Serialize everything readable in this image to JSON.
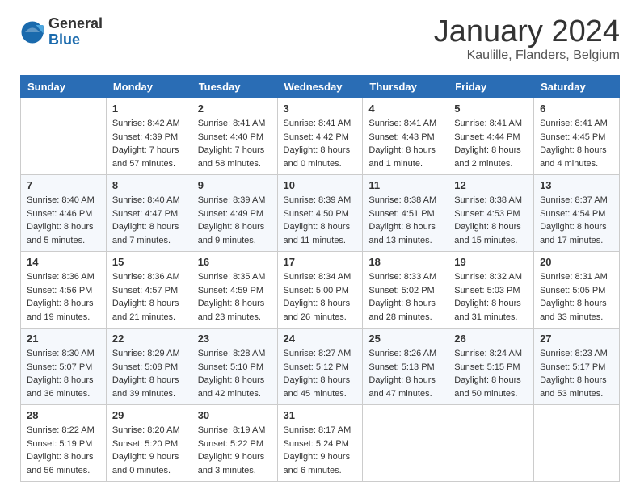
{
  "header": {
    "logo_general": "General",
    "logo_blue": "Blue",
    "month_title": "January 2024",
    "location": "Kaulille, Flanders, Belgium"
  },
  "days_of_week": [
    "Sunday",
    "Monday",
    "Tuesday",
    "Wednesday",
    "Thursday",
    "Friday",
    "Saturday"
  ],
  "weeks": [
    [
      {
        "day": "",
        "info": ""
      },
      {
        "day": "1",
        "info": "Sunrise: 8:42 AM\nSunset: 4:39 PM\nDaylight: 7 hours\nand 57 minutes."
      },
      {
        "day": "2",
        "info": "Sunrise: 8:41 AM\nSunset: 4:40 PM\nDaylight: 7 hours\nand 58 minutes."
      },
      {
        "day": "3",
        "info": "Sunrise: 8:41 AM\nSunset: 4:42 PM\nDaylight: 8 hours\nand 0 minutes."
      },
      {
        "day": "4",
        "info": "Sunrise: 8:41 AM\nSunset: 4:43 PM\nDaylight: 8 hours\nand 1 minute."
      },
      {
        "day": "5",
        "info": "Sunrise: 8:41 AM\nSunset: 4:44 PM\nDaylight: 8 hours\nand 2 minutes."
      },
      {
        "day": "6",
        "info": "Sunrise: 8:41 AM\nSunset: 4:45 PM\nDaylight: 8 hours\nand 4 minutes."
      }
    ],
    [
      {
        "day": "7",
        "info": "Sunrise: 8:40 AM\nSunset: 4:46 PM\nDaylight: 8 hours\nand 5 minutes."
      },
      {
        "day": "8",
        "info": "Sunrise: 8:40 AM\nSunset: 4:47 PM\nDaylight: 8 hours\nand 7 minutes."
      },
      {
        "day": "9",
        "info": "Sunrise: 8:39 AM\nSunset: 4:49 PM\nDaylight: 8 hours\nand 9 minutes."
      },
      {
        "day": "10",
        "info": "Sunrise: 8:39 AM\nSunset: 4:50 PM\nDaylight: 8 hours\nand 11 minutes."
      },
      {
        "day": "11",
        "info": "Sunrise: 8:38 AM\nSunset: 4:51 PM\nDaylight: 8 hours\nand 13 minutes."
      },
      {
        "day": "12",
        "info": "Sunrise: 8:38 AM\nSunset: 4:53 PM\nDaylight: 8 hours\nand 15 minutes."
      },
      {
        "day": "13",
        "info": "Sunrise: 8:37 AM\nSunset: 4:54 PM\nDaylight: 8 hours\nand 17 minutes."
      }
    ],
    [
      {
        "day": "14",
        "info": "Sunrise: 8:36 AM\nSunset: 4:56 PM\nDaylight: 8 hours\nand 19 minutes."
      },
      {
        "day": "15",
        "info": "Sunrise: 8:36 AM\nSunset: 4:57 PM\nDaylight: 8 hours\nand 21 minutes."
      },
      {
        "day": "16",
        "info": "Sunrise: 8:35 AM\nSunset: 4:59 PM\nDaylight: 8 hours\nand 23 minutes."
      },
      {
        "day": "17",
        "info": "Sunrise: 8:34 AM\nSunset: 5:00 PM\nDaylight: 8 hours\nand 26 minutes."
      },
      {
        "day": "18",
        "info": "Sunrise: 8:33 AM\nSunset: 5:02 PM\nDaylight: 8 hours\nand 28 minutes."
      },
      {
        "day": "19",
        "info": "Sunrise: 8:32 AM\nSunset: 5:03 PM\nDaylight: 8 hours\nand 31 minutes."
      },
      {
        "day": "20",
        "info": "Sunrise: 8:31 AM\nSunset: 5:05 PM\nDaylight: 8 hours\nand 33 minutes."
      }
    ],
    [
      {
        "day": "21",
        "info": "Sunrise: 8:30 AM\nSunset: 5:07 PM\nDaylight: 8 hours\nand 36 minutes."
      },
      {
        "day": "22",
        "info": "Sunrise: 8:29 AM\nSunset: 5:08 PM\nDaylight: 8 hours\nand 39 minutes."
      },
      {
        "day": "23",
        "info": "Sunrise: 8:28 AM\nSunset: 5:10 PM\nDaylight: 8 hours\nand 42 minutes."
      },
      {
        "day": "24",
        "info": "Sunrise: 8:27 AM\nSunset: 5:12 PM\nDaylight: 8 hours\nand 45 minutes."
      },
      {
        "day": "25",
        "info": "Sunrise: 8:26 AM\nSunset: 5:13 PM\nDaylight: 8 hours\nand 47 minutes."
      },
      {
        "day": "26",
        "info": "Sunrise: 8:24 AM\nSunset: 5:15 PM\nDaylight: 8 hours\nand 50 minutes."
      },
      {
        "day": "27",
        "info": "Sunrise: 8:23 AM\nSunset: 5:17 PM\nDaylight: 8 hours\nand 53 minutes."
      }
    ],
    [
      {
        "day": "28",
        "info": "Sunrise: 8:22 AM\nSunset: 5:19 PM\nDaylight: 8 hours\nand 56 minutes."
      },
      {
        "day": "29",
        "info": "Sunrise: 8:20 AM\nSunset: 5:20 PM\nDaylight: 9 hours\nand 0 minutes."
      },
      {
        "day": "30",
        "info": "Sunrise: 8:19 AM\nSunset: 5:22 PM\nDaylight: 9 hours\nand 3 minutes."
      },
      {
        "day": "31",
        "info": "Sunrise: 8:17 AM\nSunset: 5:24 PM\nDaylight: 9 hours\nand 6 minutes."
      },
      {
        "day": "",
        "info": ""
      },
      {
        "day": "",
        "info": ""
      },
      {
        "day": "",
        "info": ""
      }
    ]
  ]
}
